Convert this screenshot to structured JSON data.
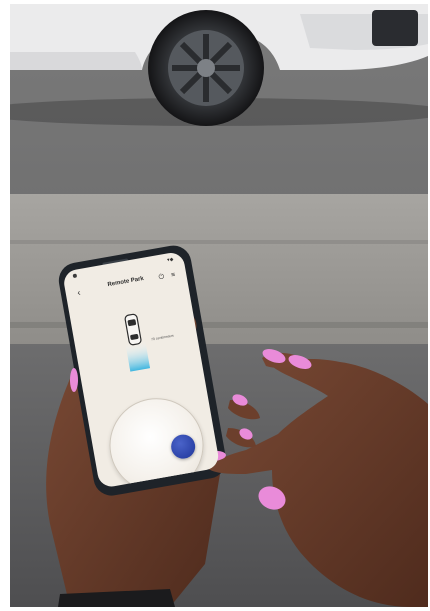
{
  "scene": {
    "app": {
      "title": "Remote Park",
      "distance_label": "70 centimeters",
      "icons": [
        "back-chevron-icon",
        "power-icon",
        "menu-icon"
      ],
      "status_signal": "▾◆"
    }
  },
  "colors": {
    "car_body": "#e9e9ea",
    "tire": "#1f1f21",
    "asphalt": "#6b6b6c",
    "curb_stone": "#9e9c98",
    "phone_body": "#1e2329",
    "screen_bg": "#f1ece4",
    "knob_blue": "#2c43a8",
    "nail_pink": "#e98bd9",
    "skin": "#6a3e2c"
  }
}
